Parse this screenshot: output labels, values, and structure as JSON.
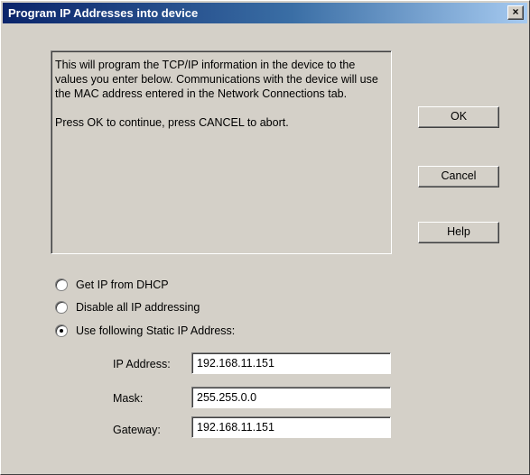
{
  "dialog": {
    "title": "Program IP Addresses into device",
    "close_label": "×"
  },
  "info": {
    "paragraph1": "This will program the TCP/IP information in the device to the values you enter below. Communications with the device will use the MAC address entered in the Network Connections tab.",
    "paragraph2": "Press OK to continue, press CANCEL to abort."
  },
  "buttons": {
    "ok": "OK",
    "cancel": "Cancel",
    "help": "Help"
  },
  "options": {
    "dhcp": "Get IP from DHCP",
    "disable": "Disable all IP addressing",
    "static": "Use following Static IP Address:",
    "selected": "static"
  },
  "fields": {
    "ip_label": "IP Address:",
    "ip_value": "192.168.11.151",
    "mask_label": "Mask:",
    "mask_value": "255.255.0.0",
    "gateway_label": "Gateway:",
    "gateway_value": "192.168.11.151"
  }
}
